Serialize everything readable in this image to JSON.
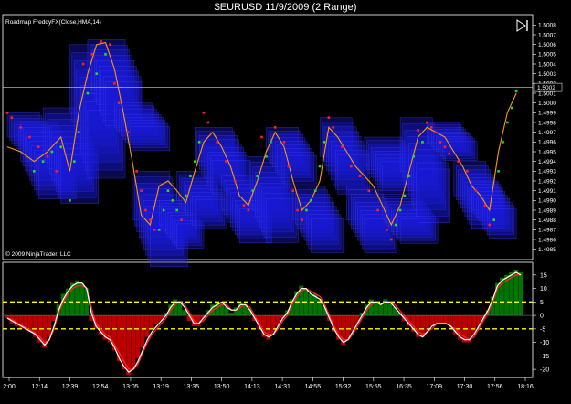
{
  "window": {
    "title": "$EURUSD  11/9/2009 (2 Range)"
  },
  "colors": {
    "background": "#000000",
    "box": "#1a1ad8",
    "boxEdge": "#4040ff",
    "red_dot": "#ff2020",
    "green_dot": "#20e020",
    "hma": "#ff9a00",
    "hist_pos": "#008800",
    "hist_neg": "#dd0000",
    "osc_signal": "#ff2020",
    "osc_main": "#ffffff",
    "level": "#ffff00",
    "axis": "#ffffff"
  },
  "icons": {
    "play": "skip-forward-icon"
  },
  "chart_data": [
    {
      "type": "line",
      "panel": "price",
      "indicator_label": "Roadmap FreddyFX(Close,HMA,14)",
      "copyright": "© 2009 NinjaTrader, LLC",
      "y_ticks": [
        "1.5008",
        "1.5007",
        "1.5006",
        "1.5005",
        "1.5004",
        "1.5003",
        "1.5002",
        "1.5001",
        "1.5000",
        "1.4999",
        "1.4998",
        "1.4997",
        "1.4996",
        "1.4995",
        "1.4994",
        "1.4993",
        "1.4992",
        "1.4991",
        "1.4990",
        "1.4989",
        "1.4988",
        "1.4987",
        "1.4986",
        "1.4985"
      ],
      "ylim": [
        1.49845,
        1.50085
      ],
      "current_price_label": "1.5002",
      "current_price": 1.50016,
      "x_ticks": [
        "2:00",
        "12:14",
        "12:39",
        "12:54",
        "13:05",
        "13:19",
        "13:35",
        "13:50",
        "14:13",
        "14:31",
        "14:55",
        "15:32",
        "15:55",
        "16:35",
        "17:09",
        "17:30",
        "17:56",
        "18:16"
      ],
      "hma": [
        [
          0,
          1.49955
        ],
        [
          3,
          1.4995
        ],
        [
          6,
          1.4994
        ],
        [
          9,
          1.4995
        ],
        [
          12,
          1.49965
        ],
        [
          14,
          1.4993
        ],
        [
          16,
          1.4999
        ],
        [
          18,
          1.5003
        ],
        [
          20,
          1.5006
        ],
        [
          22,
          1.50062
        ],
        [
          24,
          1.50035
        ],
        [
          26,
          1.4999
        ],
        [
          28,
          1.4994
        ],
        [
          30,
          1.49885
        ],
        [
          32,
          1.49875
        ],
        [
          34,
          1.49915
        ],
        [
          36,
          1.4992
        ],
        [
          38,
          1.4991
        ],
        [
          40,
          1.49898
        ],
        [
          42,
          1.4993
        ],
        [
          44,
          1.4996
        ],
        [
          46,
          1.4997
        ],
        [
          48,
          1.49955
        ],
        [
          50,
          1.49935
        ],
        [
          52,
          1.49905
        ],
        [
          54,
          1.49895
        ],
        [
          56,
          1.4992
        ],
        [
          58,
          1.4995
        ],
        [
          60,
          1.4997
        ],
        [
          62,
          1.49955
        ],
        [
          64,
          1.4992
        ],
        [
          66,
          1.4989
        ],
        [
          68,
          1.499
        ],
        [
          70,
          1.4992
        ],
        [
          72,
          1.49975
        ],
        [
          74,
          1.49965
        ],
        [
          76,
          1.4995
        ],
        [
          78,
          1.49935
        ],
        [
          80,
          1.49925
        ],
        [
          82,
          1.49915
        ],
        [
          84,
          1.49895
        ],
        [
          86,
          1.49875
        ],
        [
          88,
          1.49895
        ],
        [
          90,
          1.4993
        ],
        [
          92,
          1.49965
        ],
        [
          94,
          1.49975
        ],
        [
          96,
          1.4997
        ],
        [
          98,
          1.49965
        ],
        [
          100,
          1.4995
        ],
        [
          102,
          1.49935
        ],
        [
          104,
          1.49915
        ],
        [
          106,
          1.49905
        ],
        [
          108,
          1.4989
        ],
        [
          110,
          1.4995
        ],
        [
          112,
          1.4999
        ],
        [
          114,
          1.5001
        ]
      ],
      "red_dots": [
        [
          0,
          1.4999
        ],
        [
          1,
          1.49985
        ],
        [
          3,
          1.49975
        ],
        [
          5,
          1.49965
        ],
        [
          7,
          1.49955
        ],
        [
          9,
          1.49945
        ],
        [
          11,
          1.4993
        ],
        [
          17,
          1.5004
        ],
        [
          19,
          1.5005
        ],
        [
          21,
          1.50063
        ],
        [
          23,
          1.5006
        ],
        [
          24,
          1.5002
        ],
        [
          25,
          1.5
        ],
        [
          27,
          1.4997
        ],
        [
          29,
          1.4993
        ],
        [
          30,
          1.4991
        ],
        [
          31,
          1.4989
        ],
        [
          32,
          1.4988
        ],
        [
          33,
          1.4987
        ],
        [
          39,
          1.4988
        ],
        [
          44,
          1.4999
        ],
        [
          45,
          1.4998
        ],
        [
          47,
          1.4996
        ],
        [
          49,
          1.4994
        ],
        [
          51,
          1.4992
        ],
        [
          53,
          1.49895
        ],
        [
          54,
          1.4989
        ],
        [
          57,
          1.49965
        ],
        [
          60,
          1.49975
        ],
        [
          62,
          1.4996
        ],
        [
          63,
          1.49935
        ],
        [
          64,
          1.4991
        ],
        [
          65,
          1.4989
        ],
        [
          66,
          1.4988
        ],
        [
          72,
          1.49985
        ],
        [
          73,
          1.49975
        ],
        [
          75,
          1.49955
        ],
        [
          77,
          1.49935
        ],
        [
          79,
          1.49925
        ],
        [
          81,
          1.4991
        ],
        [
          83,
          1.4989
        ],
        [
          85,
          1.4987
        ],
        [
          86,
          1.4986
        ],
        [
          92,
          1.49972
        ],
        [
          94,
          1.4998
        ],
        [
          95,
          1.49975
        ],
        [
          96,
          1.4997
        ],
        [
          97,
          1.4996
        ],
        [
          98,
          1.49955
        ],
        [
          99,
          1.49948
        ],
        [
          101,
          1.4994
        ],
        [
          103,
          1.4993
        ],
        [
          105,
          1.4991
        ],
        [
          107,
          1.49895
        ],
        [
          108,
          1.49875
        ]
      ],
      "green_dots": [
        [
          6,
          1.4993
        ],
        [
          8,
          1.4994
        ],
        [
          10,
          1.4995
        ],
        [
          12,
          1.49955
        ],
        [
          14,
          1.499
        ],
        [
          15,
          1.4994
        ],
        [
          16,
          1.4997
        ],
        [
          18,
          1.5001
        ],
        [
          20,
          1.5003
        ],
        [
          22,
          1.5005
        ],
        [
          34,
          1.4987
        ],
        [
          35,
          1.4989
        ],
        [
          36,
          1.4991
        ],
        [
          37,
          1.499
        ],
        [
          38,
          1.4989
        ],
        [
          40,
          1.49905
        ],
        [
          41,
          1.49925
        ],
        [
          42,
          1.4994
        ],
        [
          43,
          1.4996
        ],
        [
          55,
          1.4991
        ],
        [
          56,
          1.49925
        ],
        [
          58,
          1.49945
        ],
        [
          59,
          1.4996
        ],
        [
          67,
          1.4989
        ],
        [
          68,
          1.499
        ],
        [
          69,
          1.4991
        ],
        [
          70,
          1.49935
        ],
        [
          71,
          1.4996
        ],
        [
          87,
          1.49875
        ],
        [
          88,
          1.4989
        ],
        [
          89,
          1.49905
        ],
        [
          90,
          1.49925
        ],
        [
          91,
          1.49945
        ],
        [
          93,
          1.4996
        ],
        [
          109,
          1.4988
        ],
        [
          110,
          1.4993
        ],
        [
          111,
          1.4996
        ],
        [
          112,
          1.4998
        ],
        [
          113,
          1.49995
        ],
        [
          114,
          1.50012
        ]
      ],
      "boxes": [
        [
          0,
          1.49965,
          1.4999,
          12
        ],
        [
          3,
          1.4994,
          1.4998,
          14
        ],
        [
          8,
          1.49945,
          1.49995,
          14
        ],
        [
          14,
          1.4999,
          1.5006,
          14
        ],
        [
          18,
          1.5002,
          1.50065,
          14
        ],
        [
          24,
          1.49975,
          1.5,
          14
        ],
        [
          28,
          1.4988,
          1.4993,
          14
        ],
        [
          34,
          1.49875,
          1.499,
          10
        ],
        [
          38,
          1.499,
          1.4993,
          12
        ],
        [
          42,
          1.4994,
          1.49975,
          14
        ],
        [
          48,
          1.4989,
          1.49925,
          12
        ],
        [
          54,
          1.499,
          1.49945,
          12
        ],
        [
          58,
          1.49945,
          1.49975,
          12
        ],
        [
          64,
          1.4988,
          1.49915,
          12
        ],
        [
          70,
          1.49945,
          1.49985,
          12
        ],
        [
          76,
          1.4988,
          1.49915,
          12
        ],
        [
          80,
          1.49935,
          1.49965,
          14
        ],
        [
          84,
          1.4988,
          1.49905,
          14
        ],
        [
          88,
          1.4993,
          1.49985,
          12
        ],
        [
          94,
          1.4996,
          1.4998,
          12
        ],
        [
          100,
          1.49905,
          1.4994,
          12
        ],
        [
          104,
          1.4989,
          1.4992,
          10
        ]
      ]
    },
    {
      "type": "bar",
      "panel": "oscillator",
      "y_ticks": [
        "15",
        "10",
        "5",
        "0",
        "-5",
        "-10",
        "-15",
        "-20"
      ],
      "ylim": [
        -22,
        18
      ],
      "levels": [
        5,
        -5
      ],
      "histogram": [
        -1,
        -3,
        -4,
        -5,
        -5,
        -6,
        -8,
        -10,
        -12,
        -8,
        -2,
        4,
        8,
        10,
        12,
        13,
        12,
        10,
        -2,
        -5,
        -7,
        -9,
        -10,
        -13,
        -17,
        -20,
        -22,
        -20,
        -16,
        -12,
        -8,
        -5,
        -3,
        -2,
        1,
        4,
        6,
        5,
        2,
        -2,
        -4,
        -4,
        -1,
        2,
        4,
        5,
        5,
        3,
        1,
        3,
        5,
        4,
        2,
        -2,
        -5,
        -8,
        -9,
        -7,
        -4,
        -1,
        2,
        6,
        9,
        11,
        10,
        8,
        8,
        6,
        3,
        -2,
        -6,
        -9,
        -11,
        -9,
        -6,
        -3,
        1,
        4,
        6,
        5,
        4,
        6,
        5,
        3,
        1,
        -2,
        -4,
        -6,
        -8,
        -8,
        -6,
        -4,
        -3,
        -3,
        -3,
        -5,
        -7,
        -9,
        -10,
        -10,
        -7,
        -4,
        -1,
        2,
        7,
        12,
        14,
        15,
        16,
        17,
        16
      ],
      "main": [
        -1,
        -2,
        -3,
        -4,
        -5,
        -6,
        -7,
        -9,
        -11,
        -9,
        -4,
        2,
        6,
        9,
        11,
        12,
        12,
        10,
        1,
        -4,
        -6,
        -8,
        -9,
        -12,
        -16,
        -19,
        -21,
        -20,
        -17,
        -13,
        -9,
        -6,
        -4,
        -2,
        0,
        3,
        5,
        5,
        3,
        0,
        -3,
        -3,
        -1,
        1,
        3,
        4,
        5,
        3,
        2,
        2,
        4,
        4,
        2,
        -1,
        -4,
        -7,
        -8,
        -7,
        -4,
        -1,
        1,
        5,
        8,
        10,
        10,
        8,
        7,
        6,
        3,
        -1,
        -5,
        -8,
        -10,
        -9,
        -6,
        -3,
        0,
        3,
        5,
        5,
        4,
        5,
        5,
        3,
        1,
        -1,
        -3,
        -5,
        -7,
        -8,
        -6,
        -4,
        -3,
        -3,
        -3,
        -4,
        -6,
        -8,
        -9,
        -9,
        -7,
        -4,
        -1,
        2,
        6,
        11,
        13,
        14,
        15,
        16,
        15
      ],
      "signal": [
        -1,
        -1.5,
        -2.5,
        -3.5,
        -4.5,
        -5.5,
        -6.5,
        -8,
        -10,
        -9,
        -5,
        1,
        5,
        8,
        10,
        11,
        11,
        10,
        3,
        -3,
        -5,
        -7,
        -8,
        -11,
        -14,
        -17,
        -20,
        -20,
        -18,
        -14,
        -10,
        -7,
        -5,
        -3,
        -1,
        2,
        4,
        5,
        4,
        1,
        -2,
        -3,
        -2,
        0,
        2,
        3,
        4,
        4,
        2,
        2,
        3,
        4,
        3,
        0,
        -3,
        -6,
        -7,
        -7,
        -5,
        -2,
        0,
        4,
        7,
        9,
        10,
        9,
        8,
        7,
        4,
        0,
        -4,
        -7,
        -9,
        -9,
        -7,
        -4,
        -1,
        2,
        4,
        5,
        4,
        5,
        5,
        4,
        2,
        0,
        -2,
        -4,
        -6,
        -7,
        -6,
        -5,
        -3,
        -3,
        -3,
        -4,
        -5,
        -7,
        -8,
        -9,
        -8,
        -5,
        -2,
        1,
        5,
        10,
        12,
        13,
        14,
        15,
        15
      ]
    }
  ]
}
